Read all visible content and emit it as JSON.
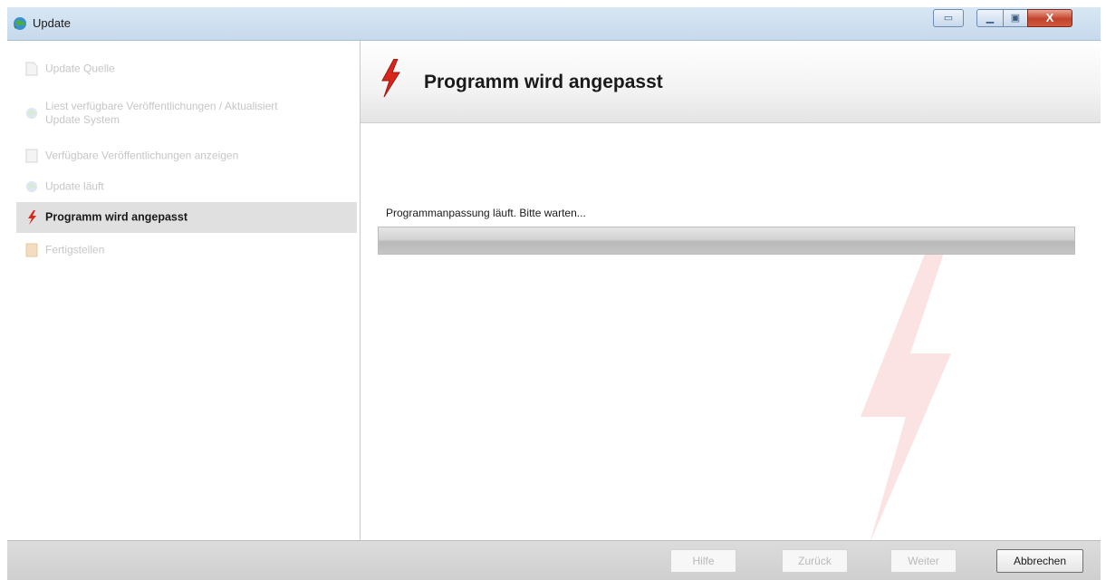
{
  "window": {
    "title": "Update",
    "close_label": "X"
  },
  "sidebar": {
    "items": [
      {
        "label": "Update Quelle",
        "state": "done",
        "icon": "document-icon"
      },
      {
        "label": "Liest verfügbare Veröffentlichungen / Aktualisiert Update System",
        "state": "done",
        "icon": "globe-icon"
      },
      {
        "label": "Verfügbare Veröffentlichungen anzeigen",
        "state": "done",
        "icon": "list-icon"
      },
      {
        "label": "Update läuft",
        "state": "done",
        "icon": "globe-icon"
      },
      {
        "label": "Programm wird angepasst",
        "state": "active",
        "icon": "lightning-icon"
      },
      {
        "label": "Fertigstellen",
        "state": "pending",
        "icon": "book-icon"
      }
    ]
  },
  "main": {
    "heading": "Programm wird angepasst",
    "status_text": "Programmanpassung läuft. Bitte warten...",
    "progress": 0
  },
  "footer": {
    "buttons": [
      {
        "label": "Hilfe",
        "enabled": false
      },
      {
        "label": "Zurück",
        "enabled": false
      },
      {
        "label": "Weiter",
        "enabled": false
      },
      {
        "label": "Abbrechen",
        "enabled": true
      }
    ]
  },
  "colors": {
    "accent_red": "#d9261c",
    "active_bg": "#e0e0e0"
  }
}
